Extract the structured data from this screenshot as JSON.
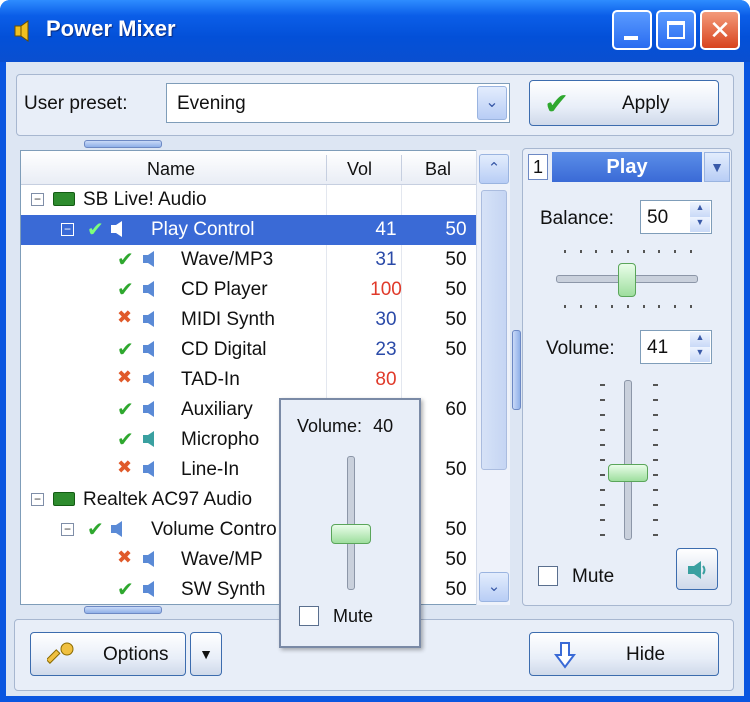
{
  "window": {
    "title": "Power Mixer"
  },
  "preset": {
    "label": "User preset:",
    "value": "Evening"
  },
  "apply": {
    "label": "Apply"
  },
  "tree": {
    "columns": {
      "name": "Name",
      "vol": "Vol",
      "bal": "Bal"
    },
    "rows": [
      {
        "name": "SB Live! Audio",
        "vol": "",
        "bal": ""
      },
      {
        "name": "Play Control",
        "vol": "41",
        "bal": "50"
      },
      {
        "name": "Wave/MP3",
        "vol": "31",
        "bal": "50"
      },
      {
        "name": "CD Player",
        "vol": "100",
        "bal": "50"
      },
      {
        "name": "MIDI Synth",
        "vol": "30",
        "bal": "50"
      },
      {
        "name": "CD Digital",
        "vol": "23",
        "bal": "50"
      },
      {
        "name": "TAD-In",
        "vol": "80",
        "bal": ""
      },
      {
        "name": "Auxiliary",
        "vol": "",
        "bal": "60"
      },
      {
        "name": "Micropho",
        "vol": "",
        "bal": ""
      },
      {
        "name": "Line-In",
        "vol": "",
        "bal": "50"
      },
      {
        "name": "Realtek AC97 Audio",
        "vol": "",
        "bal": ""
      },
      {
        "name": "Volume Contro",
        "vol": "",
        "bal": "50"
      },
      {
        "name": "Wave/MP",
        "vol": "",
        "bal": "50"
      },
      {
        "name": "SW Synth",
        "vol": "",
        "bal": "50"
      }
    ]
  },
  "line": {
    "number": "1",
    "name": "Play"
  },
  "balance": {
    "label": "Balance:",
    "value": "50",
    "level": 50
  },
  "volume": {
    "label": "Volume:",
    "value": "41",
    "level": 41
  },
  "mute": {
    "label": "Mute",
    "checked": false
  },
  "popup": {
    "label": "Volume:",
    "value": "40",
    "level": 40,
    "mute_label": "Mute"
  },
  "options": {
    "label": "Options"
  },
  "hide": {
    "label": "Hide"
  },
  "colors": {
    "selection": "#3a6ad6",
    "titlebar": "#0a56e0",
    "red_value": "#e03a2a"
  }
}
